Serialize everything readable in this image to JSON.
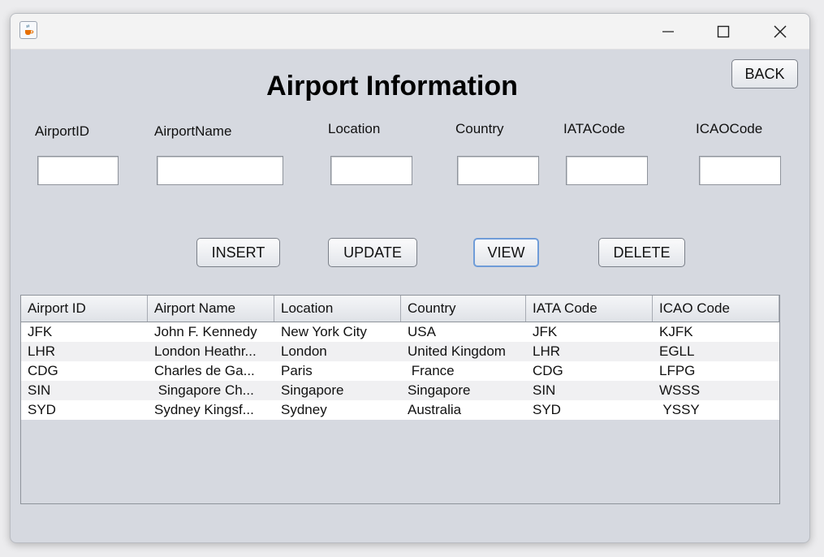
{
  "window": {
    "icon": "java-cup-icon",
    "controls": [
      "minimize-icon",
      "maximize-icon",
      "close-icon"
    ]
  },
  "header": {
    "title": "Airport Information",
    "back_label": "BACK"
  },
  "form": {
    "fields": [
      {
        "label": "AirportID",
        "value": ""
      },
      {
        "label": "AirportName",
        "value": ""
      },
      {
        "label": "Location",
        "value": ""
      },
      {
        "label": "Country",
        "value": ""
      },
      {
        "label": "IATACode",
        "value": ""
      },
      {
        "label": "ICAOCode",
        "value": ""
      }
    ]
  },
  "actions": {
    "insert": "INSERT",
    "update": "UPDATE",
    "view": "VIEW",
    "delete": "DELETE"
  },
  "table": {
    "columns": [
      "Airport ID",
      "Airport Name",
      "Location",
      "Country",
      "IATA Code",
      "ICAO Code"
    ],
    "rows": [
      [
        "JFK",
        "John F. Kennedy",
        "New York City",
        "USA",
        "JFK",
        "KJFK"
      ],
      [
        "LHR",
        "London Heathr...",
        "London",
        "United Kingdom",
        "LHR",
        "EGLL"
      ],
      [
        "CDG",
        "Charles de Ga...",
        "Paris",
        " France",
        "CDG",
        "LFPG"
      ],
      [
        "SIN",
        " Singapore Ch...",
        "Singapore",
        "Singapore",
        "SIN",
        "WSSS"
      ],
      [
        "SYD",
        "Sydney Kingsf...",
        "Sydney",
        "Australia",
        "SYD",
        " YSSY"
      ]
    ]
  }
}
